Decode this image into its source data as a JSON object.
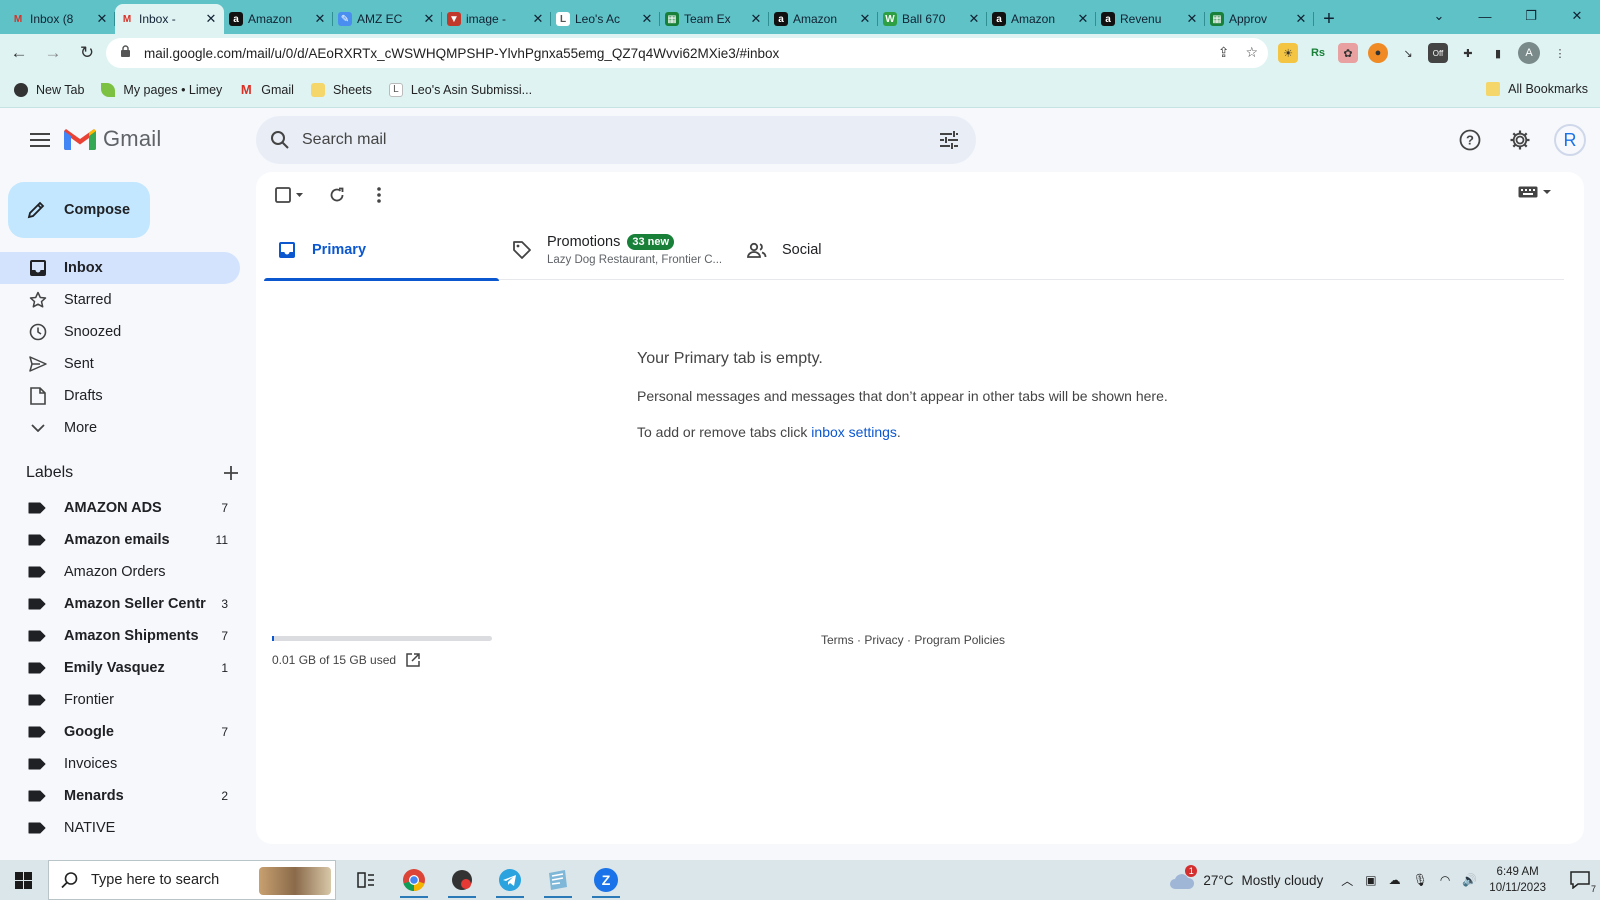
{
  "browser": {
    "tabs": [
      {
        "label": "Inbox (8",
        "favicon": "gmail-icon",
        "color": "#d93025",
        "active": false
      },
      {
        "label": "Inbox - ",
        "favicon": "gmail-icon",
        "color": "#d93025",
        "active": true
      },
      {
        "label": "Amazon",
        "favicon": "amazon-icon",
        "color": "#111111",
        "active": false
      },
      {
        "label": "AMZ EC",
        "favicon": "pencil-icon",
        "color": "#4a8ef0",
        "active": false
      },
      {
        "label": "image -",
        "favicon": "triangle-icon",
        "color": "#c0392b",
        "active": false
      },
      {
        "label": "Leo's Ac",
        "favicon": "leo-icon",
        "color": "#ffffff",
        "active": false
      },
      {
        "label": "Team Ex",
        "favicon": "sheets-icon",
        "color": "#188038",
        "active": false
      },
      {
        "label": "Amazon",
        "favicon": "amazon-icon",
        "color": "#111111",
        "active": false
      },
      {
        "label": "Ball 670",
        "favicon": "w-icon",
        "color": "#2ea043",
        "active": false
      },
      {
        "label": "Amazon",
        "favicon": "amazon-icon",
        "color": "#111111",
        "active": false
      },
      {
        "label": "Revenu",
        "favicon": "amazon-icon",
        "color": "#111111",
        "active": false
      },
      {
        "label": "Approv",
        "favicon": "sheets-icon",
        "color": "#188038",
        "active": false
      }
    ],
    "url": "mail.google.com/mail/u/0/d/AEoRXRTx_cWSWHQMPSHP-YlvhPgnxa55emg_QZ7q4Wvvi62MXie3/#inbox",
    "profile_initial": "A",
    "ext_off_label": "Off",
    "bookmarks": [
      {
        "label": "New Tab",
        "icon": "globe-icon",
        "color": "#333333"
      },
      {
        "label": "My pages • Limey",
        "icon": "leaf-icon",
        "color": "#7cc142"
      },
      {
        "label": "Gmail",
        "icon": "gmail-icon",
        "color": "#d93025"
      },
      {
        "label": "Sheets",
        "icon": "folder-icon",
        "color": "#f5d66b"
      },
      {
        "label": "Leo's Asin Submissi...",
        "icon": "leo-icon",
        "color": "#ffffff"
      }
    ],
    "all_bookmarks": "All Bookmarks"
  },
  "gmail": {
    "brand": "Gmail",
    "search_placeholder": "Search mail",
    "account_initial": "R",
    "compose_label": "Compose",
    "nav": [
      {
        "label": "Inbox",
        "icon": "inbox-icon",
        "active": true
      },
      {
        "label": "Starred",
        "icon": "star-icon",
        "active": false
      },
      {
        "label": "Snoozed",
        "icon": "clock-icon",
        "active": false
      },
      {
        "label": "Sent",
        "icon": "send-icon",
        "active": false
      },
      {
        "label": "Drafts",
        "icon": "draft-icon",
        "active": false
      },
      {
        "label": "More",
        "icon": "chevron-down-icon",
        "active": false
      }
    ],
    "labels_title": "Labels",
    "labels": [
      {
        "label": "AMAZON ADS",
        "count": "7",
        "bold": true
      },
      {
        "label": "Amazon emails",
        "count": "11",
        "bold": true
      },
      {
        "label": "Amazon Orders",
        "count": "",
        "bold": false
      },
      {
        "label": "Amazon Seller Centr",
        "count": "3",
        "bold": true
      },
      {
        "label": "Amazon Shipments",
        "count": "7",
        "bold": true
      },
      {
        "label": "Emily Vasquez",
        "count": "1",
        "bold": true
      },
      {
        "label": "Frontier",
        "count": "",
        "bold": false
      },
      {
        "label": "Google",
        "count": "7",
        "bold": true
      },
      {
        "label": "Invoices",
        "count": "",
        "bold": false
      },
      {
        "label": "Menards",
        "count": "2",
        "bold": true
      },
      {
        "label": "NATIVE",
        "count": "",
        "bold": false
      }
    ],
    "tabs": {
      "primary": "Primary",
      "promotions": "Promotions",
      "promotions_badge": "33 new",
      "promotions_sub": "Lazy Dog Restaurant, Frontier C...",
      "social": "Social"
    },
    "empty": {
      "title": "Your Primary tab is empty.",
      "line1": "Personal messages and messages that don’t appear in other tabs will be shown here.",
      "line2_prefix": "To add or remove tabs click ",
      "line2_link": "inbox settings",
      "line2_suffix": "."
    },
    "storage_text": "0.01 GB of 15 GB used",
    "storage_used_fraction": 0.0007,
    "footer": {
      "terms": "Terms",
      "privacy": "Privacy",
      "policies": "Program Policies",
      "sep": " · "
    }
  },
  "taskbar": {
    "search_placeholder": "Type here to search",
    "apps": [
      {
        "icon": "chrome-icon",
        "running": true
      },
      {
        "icon": "record-icon",
        "running": true
      },
      {
        "icon": "telegram-icon",
        "running": true
      },
      {
        "icon": "notes-icon",
        "running": true
      },
      {
        "icon": "zoom-icon",
        "running": true
      }
    ],
    "weather_alert": "1",
    "temperature": "27°C",
    "weather": "Mostly cloudy",
    "time": "6:49 AM",
    "date": "10/11/2023",
    "notifications": "7"
  }
}
